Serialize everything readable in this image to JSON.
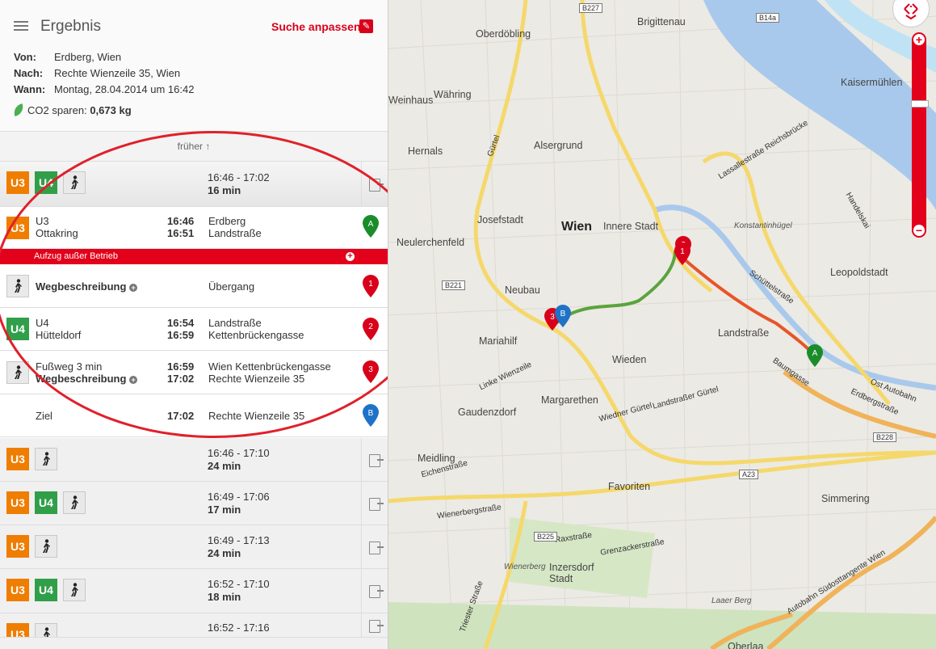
{
  "header": {
    "title": "Ergebnis",
    "adjust_label": "Suche anpassen",
    "from_label": "Von:",
    "from_value": "Erdberg, Wien",
    "to_label": "Nach:",
    "to_value": "Rechte Wienzeile 35, Wien",
    "when_label": "Wann:",
    "when_value": "Montag, 28.04.2014 um 16:42",
    "co2_label": "CO2 sparen:",
    "co2_value": "0,673 kg"
  },
  "earlier_label": "früher",
  "selected_trip": {
    "badges": [
      "U3",
      "U4",
      "walk"
    ],
    "time": "16:46 - 17:02",
    "duration": "16 min"
  },
  "alert_text": "Aufzug außer Betrieb",
  "segments": [
    {
      "line": "U3",
      "station1": "U3",
      "station2": "Ottakring",
      "t1": "16:46",
      "t2": "16:51",
      "p1": "Erdberg",
      "p2": "Landstraße",
      "marker": "A"
    },
    {
      "line": "walk",
      "station1": "Wegbeschreibung",
      "t1": "",
      "p1": "Übergang",
      "marker": "1"
    },
    {
      "line": "U4",
      "station1": "U4",
      "station2": "Hütteldorf",
      "t1": "16:54",
      "t2": "16:59",
      "p1": "Landstraße",
      "p2": "Kettenbrückengasse",
      "marker": "2"
    },
    {
      "line": "walk",
      "station1": "Fußweg 3 min",
      "station2": "Wegbeschreibung",
      "t1": "16:59",
      "t2": "17:02",
      "p1": "Wien Kettenbrückengasse",
      "p2": "Rechte Wienzeile 35",
      "marker": "3"
    },
    {
      "line": "none",
      "station1": "Ziel",
      "t1": "17:02",
      "p1": "Rechte Wienzeile 35",
      "marker": "B"
    }
  ],
  "trips": [
    {
      "badges": [
        "U3",
        "walk"
      ],
      "time": "16:46 - 17:10",
      "duration": "24 min"
    },
    {
      "badges": [
        "U3",
        "U4",
        "walk"
      ],
      "time": "16:49 - 17:06",
      "duration": "17 min"
    },
    {
      "badges": [
        "U3",
        "walk"
      ],
      "time": "16:49 - 17:13",
      "duration": "24 min"
    },
    {
      "badges": [
        "U3",
        "U4",
        "walk"
      ],
      "time": "16:52 - 17:10",
      "duration": "18 min"
    },
    {
      "badges": [
        "U3",
        "walk"
      ],
      "time": "16:52 - 17:16",
      "duration": ""
    }
  ],
  "map": {
    "districts": [
      "Wien",
      "Innere Stadt",
      "Brigittenau",
      "Oberdöbling",
      "Währing",
      "Alsergrund",
      "Josefstadt",
      "Neubau",
      "Mariahilf",
      "Wieden",
      "Margarethen",
      "Landstraße",
      "Leopoldstadt",
      "Favoriten",
      "Simmering",
      "Meidling",
      "Gaudenzdorf",
      "Hernals",
      "Kaisermühlen",
      "Inzersdorf Stadt",
      "Weinhaus",
      "Neulerchenfeld",
      "Konstantinhügel",
      "Wienerberg",
      "Laaer Berg",
      "Oberlaa"
    ],
    "streets": [
      "Gürtel",
      "Linke Wienzeile",
      "Ost Autobahn",
      "Autobahn Südosttangente Wien",
      "Wienerbergstraße",
      "Triester Straße",
      "Raxstraße",
      "Grenzackerstraße",
      "Eichenstraße",
      "Erdbergstraße",
      "Baumgasse",
      "Schüttelstraße",
      "Lassallestraße Reichsbrücke",
      "Handelskai",
      "Wiedner Gürtel",
      "Landstraßer Gürtel"
    ],
    "road_shields": [
      "B227",
      "B221",
      "B225",
      "B228",
      "A23",
      "B14a"
    ]
  }
}
